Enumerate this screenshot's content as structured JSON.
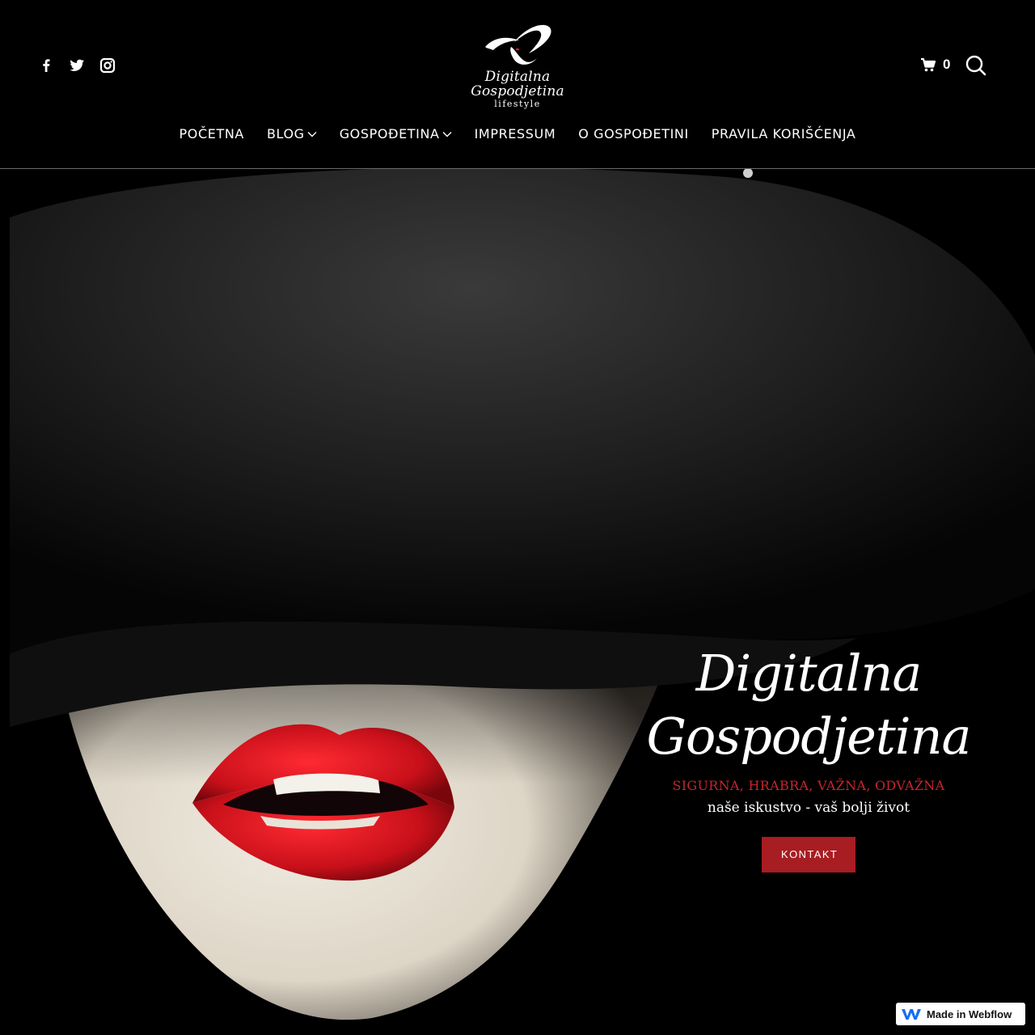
{
  "brand": {
    "logo_name": "Digitalna Gospodjetina",
    "logo_tagline": "lifestyle"
  },
  "social": [
    {
      "icon": "facebook-icon"
    },
    {
      "icon": "twitter-icon"
    },
    {
      "icon": "instagram-icon"
    }
  ],
  "cart": {
    "count": "0",
    "icon": "cart-icon"
  },
  "search": {
    "icon": "search-icon"
  },
  "nav": {
    "items": [
      {
        "label": "POČETNA"
      },
      {
        "label": "BLOG",
        "dropdown": true
      },
      {
        "label": "GOSPOĐETINA",
        "dropdown": true
      },
      {
        "label": "IMPRESSUM"
      },
      {
        "label": "O GOSPOĐETINI"
      },
      {
        "label": "PRAVILA KORIŠĆENJA"
      }
    ]
  },
  "hero": {
    "title": "Digitalna Gospodjetina",
    "tagline": "SIGURNA, HRABRA, VAŽNA, ODVAŽNA",
    "slogan": "naše iskustvo - vaš bolji život",
    "cta_label": "KONTAKT"
  },
  "badge": {
    "label": "Made in Webflow"
  },
  "colors": {
    "background": "#000000",
    "accent": "#a81d22",
    "tagline": "#c5262b",
    "lips": "#c8101a"
  }
}
